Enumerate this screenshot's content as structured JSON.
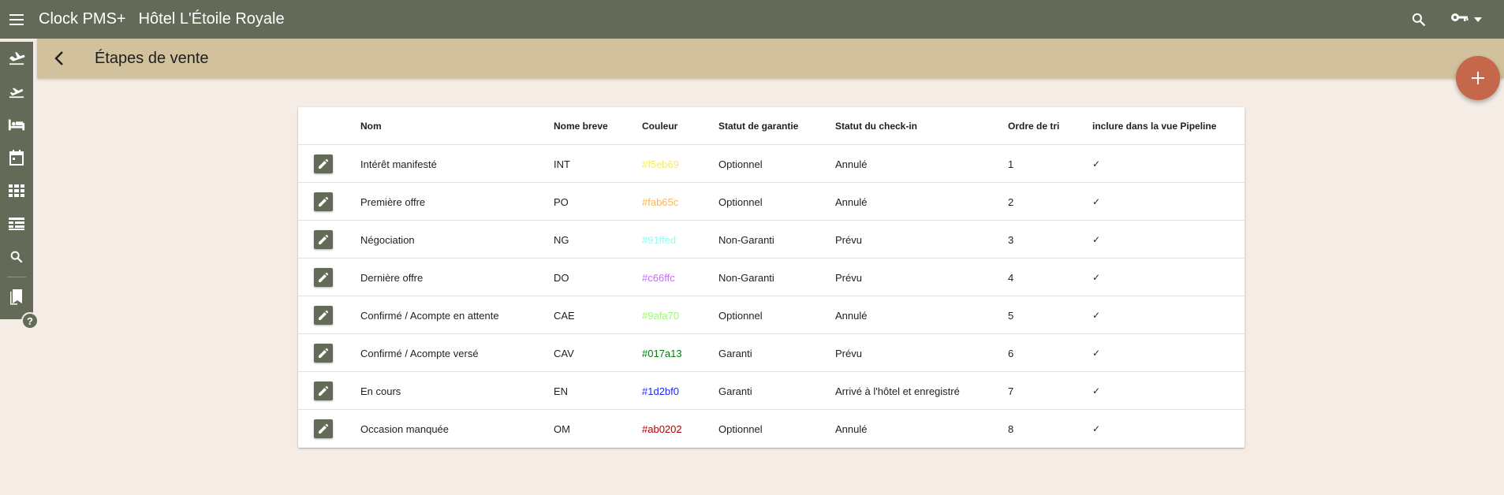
{
  "app": {
    "name": "Clock PMS+",
    "hotel": "Hôtel L'Étoile Royale"
  },
  "header": {
    "title": "Étapes de vente"
  },
  "table": {
    "columns": {
      "name": "Nom",
      "short": "Nome breve",
      "color": "Couleur",
      "guarantee": "Statut de garantie",
      "checkin": "Statut du check-in",
      "order": "Ordre de tri",
      "pipeline": "inclure dans la vue Pipeline"
    },
    "rows": [
      {
        "name": "Intérêt manifesté",
        "short": "INT",
        "color": "#f5eb69",
        "guarantee": "Optionnel",
        "checkin": "Annulé",
        "order": "1",
        "pipeline": "✓"
      },
      {
        "name": "Première offre",
        "short": "PO",
        "color": "#fab65c",
        "guarantee": "Optionnel",
        "checkin": "Annulé",
        "order": "2",
        "pipeline": "✓"
      },
      {
        "name": "Négociation",
        "short": "NG",
        "color": "#91ffed",
        "guarantee": "Non-Garanti",
        "checkin": "Prévu",
        "order": "3",
        "pipeline": "✓"
      },
      {
        "name": "Dernière offre",
        "short": "DO",
        "color": "#c66ffc",
        "guarantee": "Non-Garanti",
        "checkin": "Prévu",
        "order": "4",
        "pipeline": "✓"
      },
      {
        "name": "Confirmé / Acompte en attente",
        "short": "CAE",
        "color": "#9afa70",
        "guarantee": "Optionnel",
        "checkin": "Annulé",
        "order": "5",
        "pipeline": "✓"
      },
      {
        "name": "Confirmé / Acompte versé",
        "short": "CAV",
        "color": "#017a13",
        "guarantee": "Garanti",
        "checkin": "Prévu",
        "order": "6",
        "pipeline": "✓"
      },
      {
        "name": "En cours",
        "short": "EN",
        "color": "#1d2bf0",
        "guarantee": "Garanti",
        "checkin": "Arrivé à l'hôtel et enregistré",
        "order": "7",
        "pipeline": "✓"
      },
      {
        "name": "Occasion manquée",
        "short": "OM",
        "color": "#ab0202",
        "guarantee": "Optionnel",
        "checkin": "Annulé",
        "order": "8",
        "pipeline": "✓"
      }
    ]
  },
  "theme": {
    "topbar": "#636b58",
    "subheader": "#d1c19c",
    "fab": "#c5674a",
    "background": "#f5ede5"
  }
}
